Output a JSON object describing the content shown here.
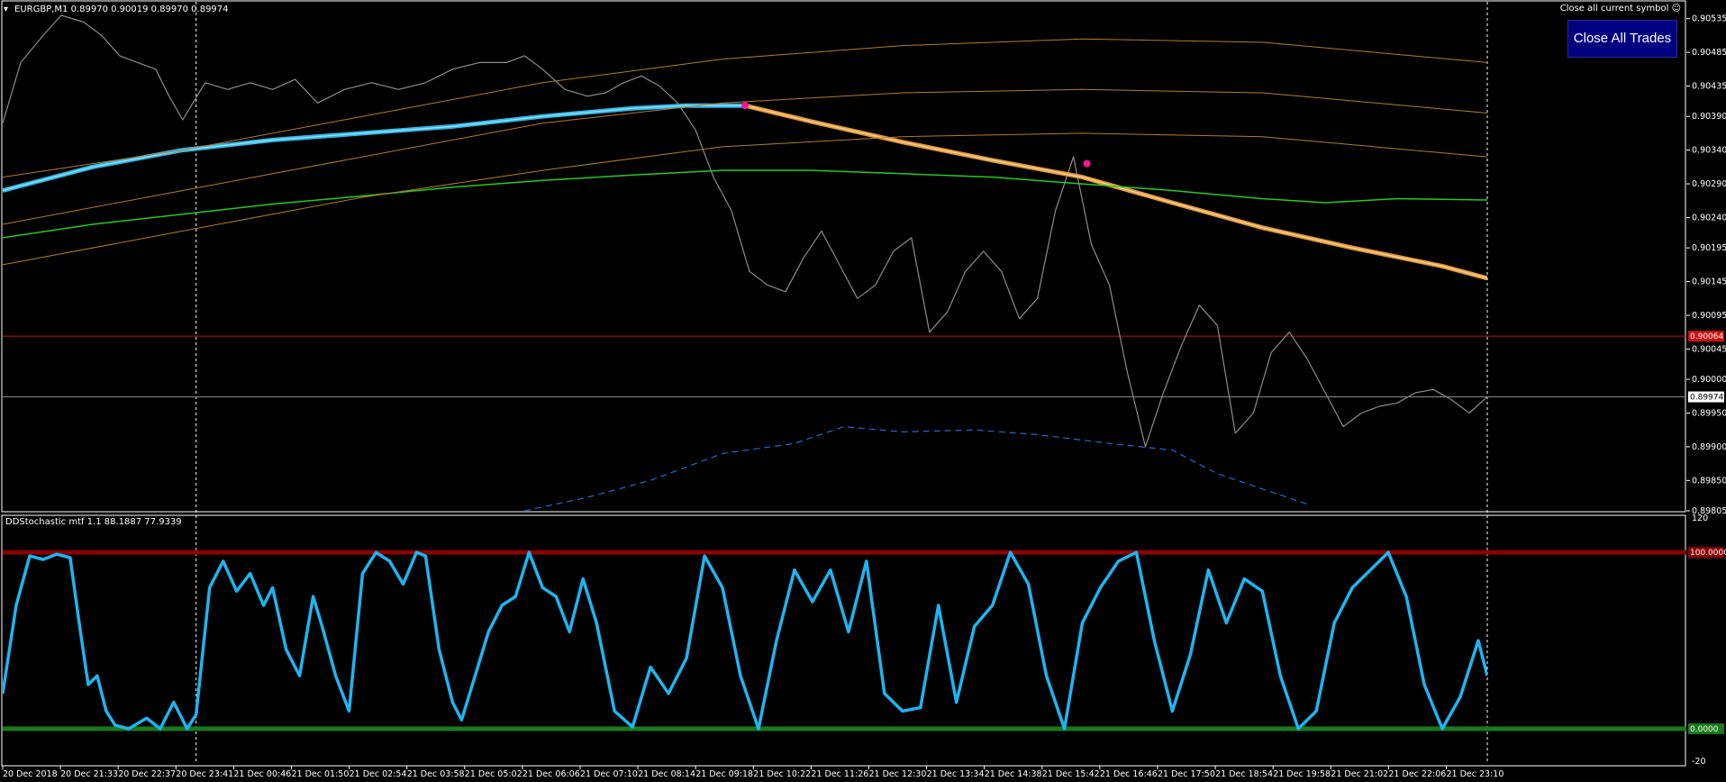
{
  "window": {
    "symbol_header": "EURGBP,M1  0.89970 0.90019 0.89970 0.89974",
    "close_symbol_label": "Close all current symbol",
    "close_all_button": "Close All Trades"
  },
  "colors": {
    "background": "#000000",
    "price": "#8c8c8c",
    "ma_fast": "#31b8e6",
    "ma_slow": "#e69a3c",
    "green_ma": "#22cc22",
    "envelope": "#b87a2a",
    "blue_dashed": "#1f6ad6",
    "red_level": "#cc1010",
    "stoch_line": "#1fb4f0",
    "stoch_upper": "#8b0000",
    "stoch_lower": "#1a7a1a",
    "pink_dot": "#ff1493"
  },
  "chart_data": [
    {
      "type": "line",
      "title": "EURGBP,M1",
      "price_axis_labels": [
        "0.90535",
        "0.90485",
        "0.90435",
        "0.90390",
        "0.90340",
        "0.90290",
        "0.90240",
        "0.90195",
        "0.90145",
        "0.90095",
        "0.90045",
        "0.90000",
        "0.89950",
        "0.89900",
        "0.89850",
        "0.89805"
      ],
      "current_price_tag": "0.89974",
      "red_level_tag": "0.90064",
      "ylim": [
        0.89805,
        0.9056
      ],
      "x_labels": [
        "20 Dec 2018",
        "20 Dec 21:33",
        "20 Dec 22:37",
        "20 Dec 23:41",
        "21 Dec 00:46",
        "21 Dec 01:50",
        "21 Dec 02:54",
        "21 Dec 03:58",
        "21 Dec 05:02",
        "21 Dec 06:06",
        "21 Dec 07:10",
        "21 Dec 08:14",
        "21 Dec 09:18",
        "21 Dec 10:22",
        "21 Dec 11:26",
        "21 Dec 12:30",
        "21 Dec 13:34",
        "21 Dec 14:38",
        "21 Dec 15:42",
        "21 Dec 16:46",
        "21 Dec 17:50",
        "21 Dec 18:54",
        "21 Dec 19:58",
        "21 Dec 21:02",
        "21 Dec 22:06",
        "21 Dec 23:10"
      ],
      "x_range": [
        0,
        1650
      ],
      "series": [
        {
          "key": "price",
          "x": [
            0,
            20,
            45,
            65,
            90,
            110,
            130,
            150,
            170,
            185,
            200,
            225,
            250,
            275,
            300,
            325,
            350,
            380,
            410,
            440,
            470,
            500,
            530,
            560,
            580,
            600,
            625,
            650,
            670,
            690,
            710,
            730,
            750,
            770,
            790,
            810,
            830,
            850,
            870,
            890,
            910,
            930,
            950,
            970,
            990,
            1010,
            1030,
            1050,
            1070,
            1090,
            1110,
            1130,
            1150,
            1170,
            1190,
            1210,
            1230,
            1250,
            1270,
            1290,
            1310,
            1330,
            1350,
            1370,
            1390,
            1410,
            1430,
            1450,
            1470,
            1490,
            1510,
            1530,
            1550,
            1570,
            1590,
            1610,
            1630,
            1650
          ],
          "values": [
            0.9038,
            0.9047,
            0.9051,
            0.9054,
            0.9053,
            0.9051,
            0.9048,
            0.9047,
            0.9046,
            0.9042,
            0.90385,
            0.9044,
            0.9043,
            0.9044,
            0.9043,
            0.90445,
            0.9041,
            0.9043,
            0.9044,
            0.9043,
            0.9044,
            0.9046,
            0.9047,
            0.9047,
            0.9048,
            0.9046,
            0.9043,
            0.9042,
            0.90425,
            0.9044,
            0.9045,
            0.90435,
            0.9041,
            0.9037,
            0.903,
            0.9025,
            0.9016,
            0.9014,
            0.9013,
            0.9018,
            0.9022,
            0.9017,
            0.9012,
            0.9014,
            0.9019,
            0.9021,
            0.9007,
            0.901,
            0.9016,
            0.9019,
            0.9016,
            0.9009,
            0.9012,
            0.9025,
            0.9033,
            0.902,
            0.9014,
            0.9001,
            0.899,
            0.8998,
            0.9005,
            0.9011,
            0.9008,
            0.8992,
            0.8995,
            0.9004,
            0.9007,
            0.9003,
            0.8998,
            0.8993,
            0.8995,
            0.8996,
            0.89965,
            0.8998,
            0.89985,
            0.8997,
            0.8995,
            0.89974
          ]
        },
        {
          "key": "ma_fast",
          "x": [
            0,
            100,
            200,
            300,
            400,
            500,
            600,
            700,
            760,
            825
          ],
          "values": [
            0.9028,
            0.90315,
            0.9034,
            0.90355,
            0.90365,
            0.90375,
            0.9039,
            0.90402,
            0.90406,
            0.90406
          ]
        },
        {
          "key": "ma_slow",
          "x": [
            825,
            900,
            1000,
            1100,
            1200,
            1300,
            1400,
            1500,
            1600,
            1650
          ],
          "values": [
            0.90406,
            0.90382,
            0.90352,
            0.90325,
            0.903,
            0.90262,
            0.90225,
            0.90195,
            0.90168,
            0.9015
          ]
        },
        {
          "key": "green_ma",
          "x": [
            0,
            100,
            200,
            300,
            400,
            500,
            600,
            700,
            800,
            900,
            1000,
            1100,
            1200,
            1300,
            1400,
            1470,
            1550,
            1650
          ],
          "values": [
            0.9021,
            0.9023,
            0.90245,
            0.9026,
            0.90272,
            0.90285,
            0.90295,
            0.90303,
            0.9031,
            0.9031,
            0.90305,
            0.903,
            0.9029,
            0.9028,
            0.90268,
            0.90262,
            0.90268,
            0.90266
          ]
        },
        {
          "key": "envelope_1",
          "x": [
            0,
            200,
            400,
            600,
            800,
            1000,
            1200,
            1400,
            1650
          ],
          "values": [
            0.903,
            0.9034,
            0.9039,
            0.9044,
            0.90475,
            0.90495,
            0.90505,
            0.905,
            0.9047
          ]
        },
        {
          "key": "envelope_2",
          "x": [
            0,
            200,
            400,
            600,
            800,
            1000,
            1200,
            1400,
            1650
          ],
          "values": [
            0.9023,
            0.9028,
            0.9033,
            0.9038,
            0.9041,
            0.90425,
            0.9043,
            0.90425,
            0.90395
          ]
        },
        {
          "key": "envelope_3",
          "x": [
            0,
            200,
            400,
            600,
            800,
            1000,
            1200,
            1400,
            1650
          ],
          "values": [
            0.9017,
            0.9022,
            0.9027,
            0.9031,
            0.90345,
            0.9036,
            0.90365,
            0.9036,
            0.9033
          ]
        },
        {
          "key": "blue_dashed",
          "x": [
            580,
            650,
            720,
            800,
            880,
            935,
            1000,
            1080,
            1150,
            1230,
            1300,
            1350,
            1450
          ],
          "values": [
            0.89805,
            0.89825,
            0.8985,
            0.8989,
            0.89905,
            0.8993,
            0.89922,
            0.89925,
            0.89918,
            0.89905,
            0.89895,
            0.8986,
            0.89815
          ]
        }
      ],
      "markers": [
        {
          "x": 825,
          "value": 0.90406
        },
        {
          "x": 1205,
          "value": 0.9032
        }
      ],
      "horizontal_lines": [
        {
          "value": 0.90064,
          "key": "red_level"
        },
        {
          "value": 0.89974,
          "key": "current"
        }
      ],
      "vertical_lines_x": [
        215,
        1650
      ]
    },
    {
      "type": "line",
      "title": "DDStochastic mtf 1.1 88.1887 77.9339",
      "ylim": [
        -20,
        120
      ],
      "axis_labels": [
        "120",
        "-20"
      ],
      "upper_level_tag": "100.0000",
      "lower_level_tag": "0.0000",
      "levels": [
        100,
        0
      ],
      "series": [
        {
          "key": "stoch",
          "x": [
            0,
            15,
            30,
            45,
            60,
            75,
            85,
            95,
            105,
            115,
            125,
            140,
            160,
            175,
            190,
            205,
            215,
            230,
            245,
            260,
            275,
            290,
            300,
            315,
            330,
            345,
            355,
            370,
            385,
            400,
            415,
            430,
            445,
            460,
            470,
            485,
            500,
            510,
            525,
            540,
            555,
            570,
            585,
            600,
            615,
            630,
            645,
            660,
            680,
            700,
            720,
            740,
            760,
            780,
            800,
            820,
            840,
            860,
            880,
            900,
            920,
            940,
            960,
            980,
            1000,
            1020,
            1040,
            1060,
            1080,
            1100,
            1120,
            1140,
            1160,
            1180,
            1200,
            1220,
            1240,
            1260,
            1280,
            1300,
            1320,
            1340,
            1360,
            1380,
            1400,
            1420,
            1440,
            1460,
            1480,
            1500,
            1520,
            1540,
            1560,
            1580,
            1600,
            1620,
            1640,
            1650
          ],
          "values": [
            20,
            70,
            98,
            96,
            99,
            97,
            60,
            25,
            30,
            10,
            2,
            0,
            6,
            0,
            15,
            0,
            8,
            80,
            95,
            78,
            88,
            70,
            80,
            45,
            30,
            75,
            58,
            30,
            10,
            88,
            100,
            95,
            82,
            100,
            98,
            45,
            15,
            5,
            30,
            55,
            70,
            75,
            100,
            80,
            75,
            55,
            85,
            60,
            10,
            1,
            35,
            20,
            40,
            98,
            80,
            30,
            0,
            50,
            90,
            72,
            90,
            55,
            95,
            20,
            10,
            12,
            70,
            15,
            58,
            70,
            100,
            82,
            30,
            0,
            60,
            80,
            95,
            100,
            50,
            10,
            42,
            90,
            60,
            85,
            78,
            30,
            0,
            10,
            60,
            80,
            90,
            100,
            75,
            25,
            0,
            18,
            50,
            30
          ]
        }
      ]
    }
  ]
}
